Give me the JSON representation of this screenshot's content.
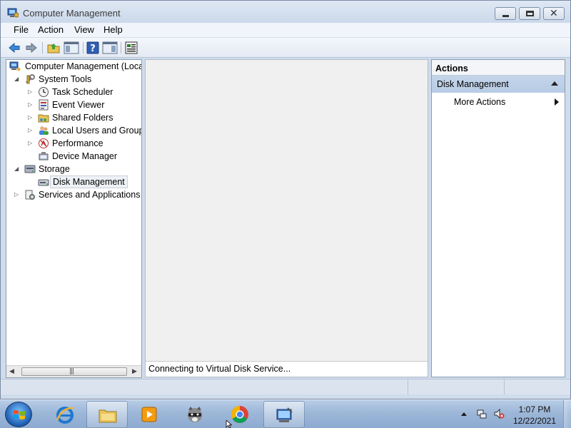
{
  "window": {
    "title": "Computer Management"
  },
  "menu": [
    "File",
    "Action",
    "View",
    "Help"
  ],
  "toolbar": [
    "back-icon",
    "forward-icon",
    "up-folder-icon",
    "show-hide-tree-icon",
    "help-icon",
    "show-hide-action-pane-icon",
    "properties-icon"
  ],
  "tree": {
    "root": "Computer Management (Local",
    "system_tools": "System Tools",
    "task_scheduler": "Task Scheduler",
    "event_viewer": "Event Viewer",
    "shared_folders": "Shared Folders",
    "local_users": "Local Users and Groups",
    "performance": "Performance",
    "device_manager": "Device Manager",
    "storage": "Storage",
    "disk_management": "Disk Management",
    "services": "Services and Applications"
  },
  "center": {
    "status": "Connecting to Virtual Disk Service..."
  },
  "actions": {
    "header": "Actions",
    "section": "Disk Management",
    "more": "More Actions"
  },
  "taskbar": {
    "apps": [
      "windows-explorer",
      "internet-explorer",
      "media-player",
      "raccoon-app",
      "chrome",
      "computer-management"
    ],
    "time": "1:07 PM",
    "date": "12/22/2021"
  },
  "colors": {
    "accent": "#b7cbe4",
    "window_bg": "#cfdcec",
    "taskbar": "#9db7d8"
  }
}
